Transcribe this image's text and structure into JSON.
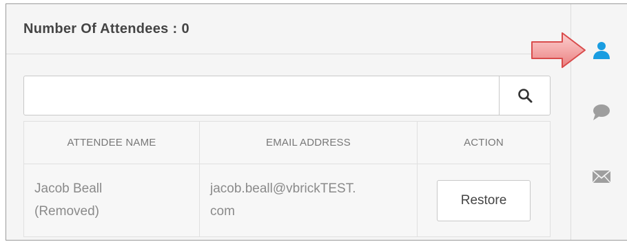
{
  "header": {
    "title": "Number Of Attendees",
    "separator": ":",
    "count": "0"
  },
  "search": {
    "value": "",
    "placeholder": ""
  },
  "table": {
    "columns": [
      "ATTENDEE NAME",
      "EMAIL ADDRESS",
      "ACTION"
    ],
    "rows": [
      {
        "name_line1": "Jacob Beall",
        "name_line2": "(Removed)",
        "email_line1": "jacob.beall@vbrickTEST.",
        "email_line2": "com",
        "action_label": "Restore"
      }
    ]
  },
  "sidebar": {
    "icons": [
      "user-icon",
      "chat-bubble-icon",
      "envelope-icon"
    ],
    "active_color": "#1a9de1",
    "inactive_color": "#9e9e9e"
  },
  "annotation": {
    "icon": "red-arrow-icon",
    "color": "#e25555"
  }
}
